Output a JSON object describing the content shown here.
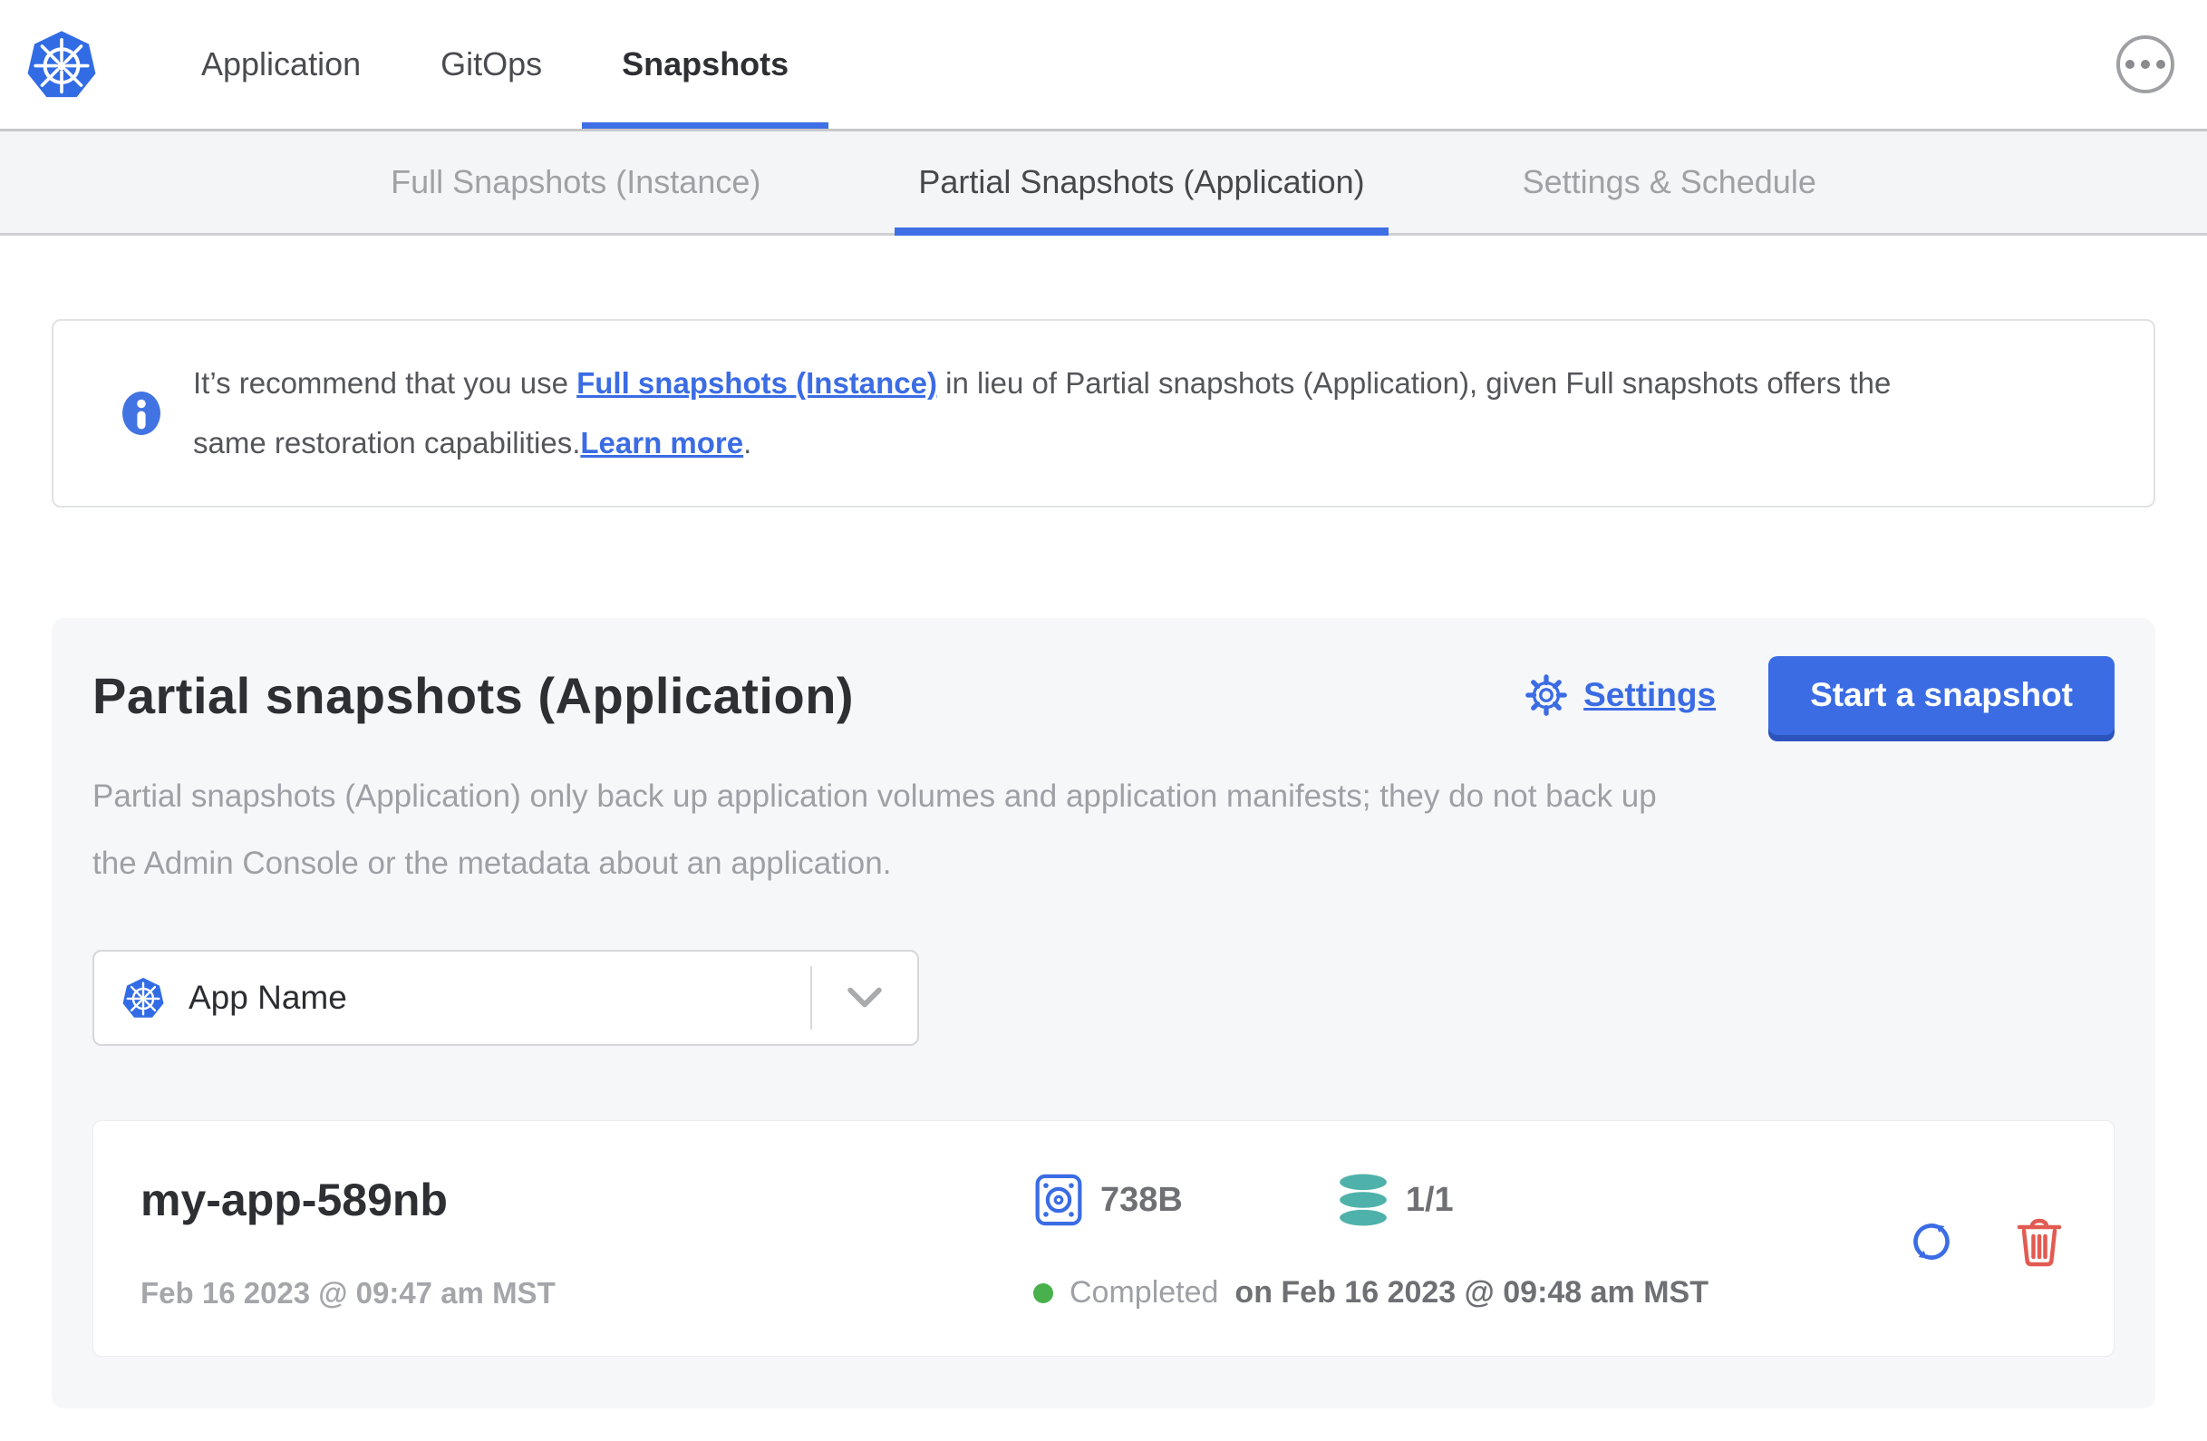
{
  "header": {
    "nav_items": [
      {
        "label": "Application",
        "active": false
      },
      {
        "label": "GitOps",
        "active": false
      },
      {
        "label": "Snapshots",
        "active": true
      }
    ]
  },
  "subnav": {
    "tabs": [
      {
        "label": "Full Snapshots (Instance)",
        "active": false
      },
      {
        "label": "Partial Snapshots (Application)",
        "active": true
      },
      {
        "label": "Settings & Schedule",
        "active": false
      }
    ]
  },
  "banner": {
    "line1_prefix": "It’s recommend that you use ",
    "line1_link": "Full snapshots (Instance)",
    "line1_rest": " in lieu of Partial snapshots (Application), given Full snapshots offers the",
    "line2_text": "same restoration capabilities.",
    "line2_link": "Learn more",
    "line2_suffix": "."
  },
  "panel": {
    "title": "Partial snapshots (Application)",
    "settings_label": "Settings",
    "start_button_label": "Start a snapshot",
    "description_lines": [
      "Partial snapshots (Application) only back up application volumes and application manifests; they do not back up",
      "the Admin Console or the metadata about an application."
    ],
    "app_selector_value": "App Name",
    "snapshots": [
      {
        "name": "my-app-589nb",
        "started": "Feb 16 2023 @ 09:47 am MST",
        "size": "738B",
        "volume_count": "1/1",
        "status": "Completed",
        "finished": "on Feb 16 2023 @ 09:48 am MST"
      }
    ]
  },
  "icons": {
    "logo": "kubernetes-logo",
    "menu": "ellipsis-icon",
    "banner": "info-icon",
    "settings": "gear-icon",
    "app_selector": "kubernetes-app-icon",
    "dropdown": "chevron-down-icon",
    "size": "volume-disk-icon",
    "volumes": "database-icon",
    "status": "status-dot",
    "restore": "restore-icon",
    "delete": "trash-icon"
  },
  "colors": {
    "primary_blue": "#3b6ce4",
    "k8s_blue": "#326ce5",
    "teal": "#4fb2aa",
    "green": "#48b14c",
    "red": "#e25b52",
    "panel_bg": "#f6f7f9",
    "subnav_bg": "#f4f5f7",
    "muted_text": "#9da0a4",
    "dark_text": "#2e2f33"
  }
}
